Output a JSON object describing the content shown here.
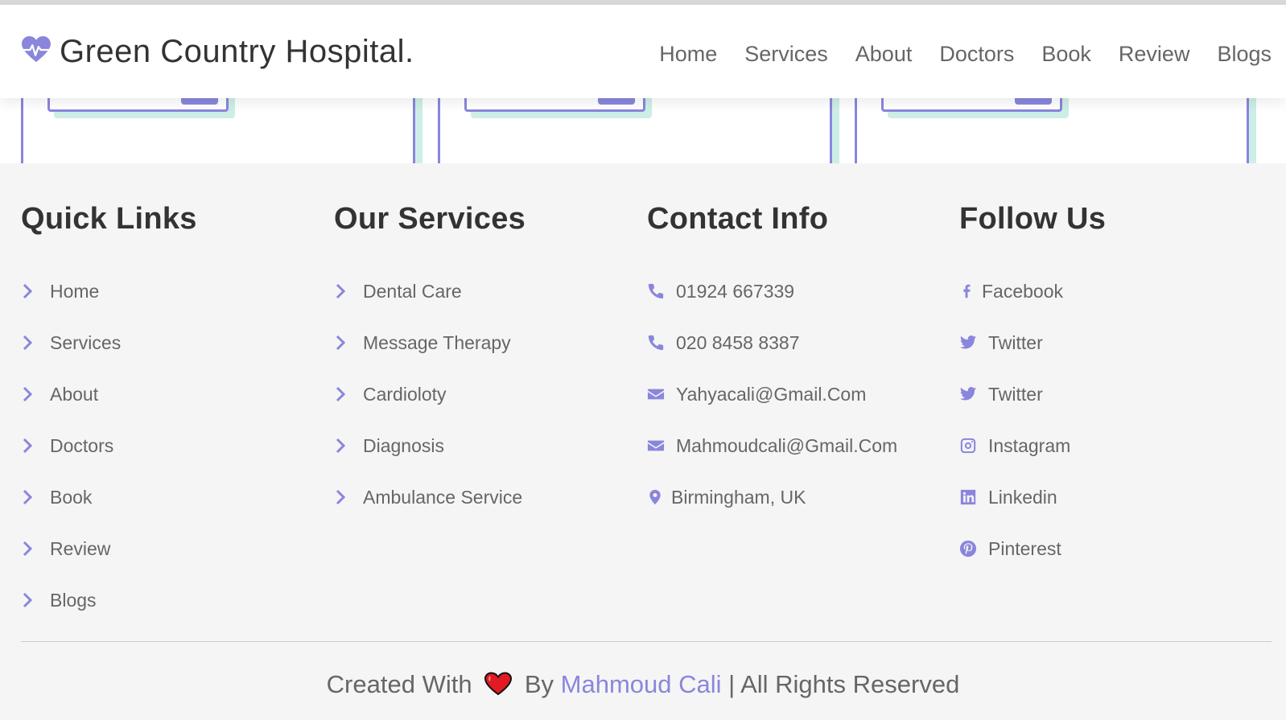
{
  "brand": {
    "name": "Green Country Hospital.",
    "icon": "heartbeat-icon",
    "accent": "#8a86dd"
  },
  "nav": {
    "items": [
      "Home",
      "Services",
      "About",
      "Doctors",
      "Book",
      "Review",
      "Blogs"
    ]
  },
  "footer": {
    "quick_links": {
      "title": "Quick Links",
      "items": [
        "Home",
        "Services",
        "About",
        "Doctors",
        "Book",
        "Review",
        "Blogs"
      ]
    },
    "services": {
      "title": "Our Services",
      "items": [
        "Dental Care",
        "Message Therapy",
        "Cardioloty",
        "Diagnosis",
        "Ambulance Service"
      ]
    },
    "contact": {
      "title": "Contact Info",
      "items": [
        {
          "icon": "phone-icon",
          "text": "01924 667339"
        },
        {
          "icon": "phone-icon",
          "text": "020 8458 8387"
        },
        {
          "icon": "envelope-icon",
          "text": "Yahyacali@Gmail.Com"
        },
        {
          "icon": "envelope-icon",
          "text": "Mahmoudcali@Gmail.Com"
        },
        {
          "icon": "map-marker-icon",
          "text": "Birmingham, UK"
        }
      ]
    },
    "follow": {
      "title": "Follow Us",
      "items": [
        {
          "icon": "facebook-icon",
          "text": "Facebook"
        },
        {
          "icon": "twitter-icon",
          "text": "Twitter"
        },
        {
          "icon": "twitter-icon",
          "text": "Twitter"
        },
        {
          "icon": "instagram-icon",
          "text": "Instagram"
        },
        {
          "icon": "linkedin-icon",
          "text": "Linkedin"
        },
        {
          "icon": "pinterest-icon",
          "text": "Pinterest"
        }
      ]
    },
    "credit": {
      "prefix": "Created With",
      "by": "By",
      "author": "Mahmoud Cali",
      "suffix": "| All Rights Reserved"
    }
  }
}
